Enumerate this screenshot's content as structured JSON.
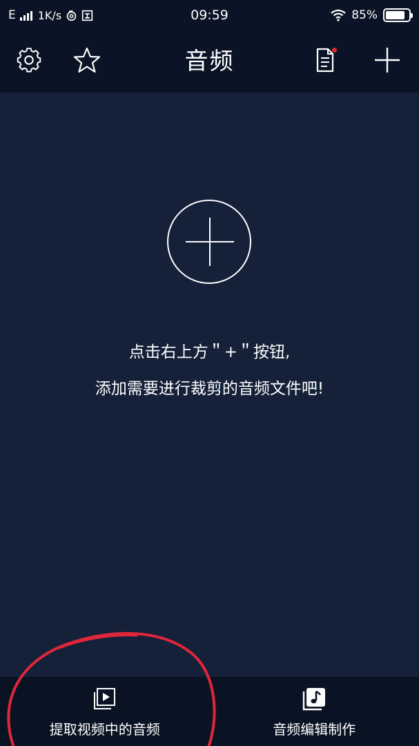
{
  "status_bar": {
    "network": "E",
    "speed": "1K/s",
    "time": "09:59",
    "battery_text": "85%",
    "battery_level": 0.85,
    "icons": [
      "signal-icon",
      "netease-icon",
      "notification-box-icon",
      "wifi-icon",
      "battery-icon"
    ]
  },
  "nav": {
    "title": "音频",
    "icons": [
      "gear-icon",
      "star-icon",
      "document-icon",
      "plus-icon"
    ],
    "badge_color": "#e0282e"
  },
  "empty_state": {
    "icon": "add-circle-icon",
    "line1": "点击右上方＂+＂按钮,",
    "line2": "添加需要进行裁剪的音频文件吧!"
  },
  "tabs": [
    {
      "label": "提取视频中的音频",
      "icon": "video-play-icon"
    },
    {
      "label": "音频编辑制作",
      "icon": "music-note-icon"
    }
  ],
  "colors": {
    "background": "#142139",
    "bar": "#0b1426",
    "tab_bar": "#0a1324",
    "annotation": "#e0263a"
  }
}
